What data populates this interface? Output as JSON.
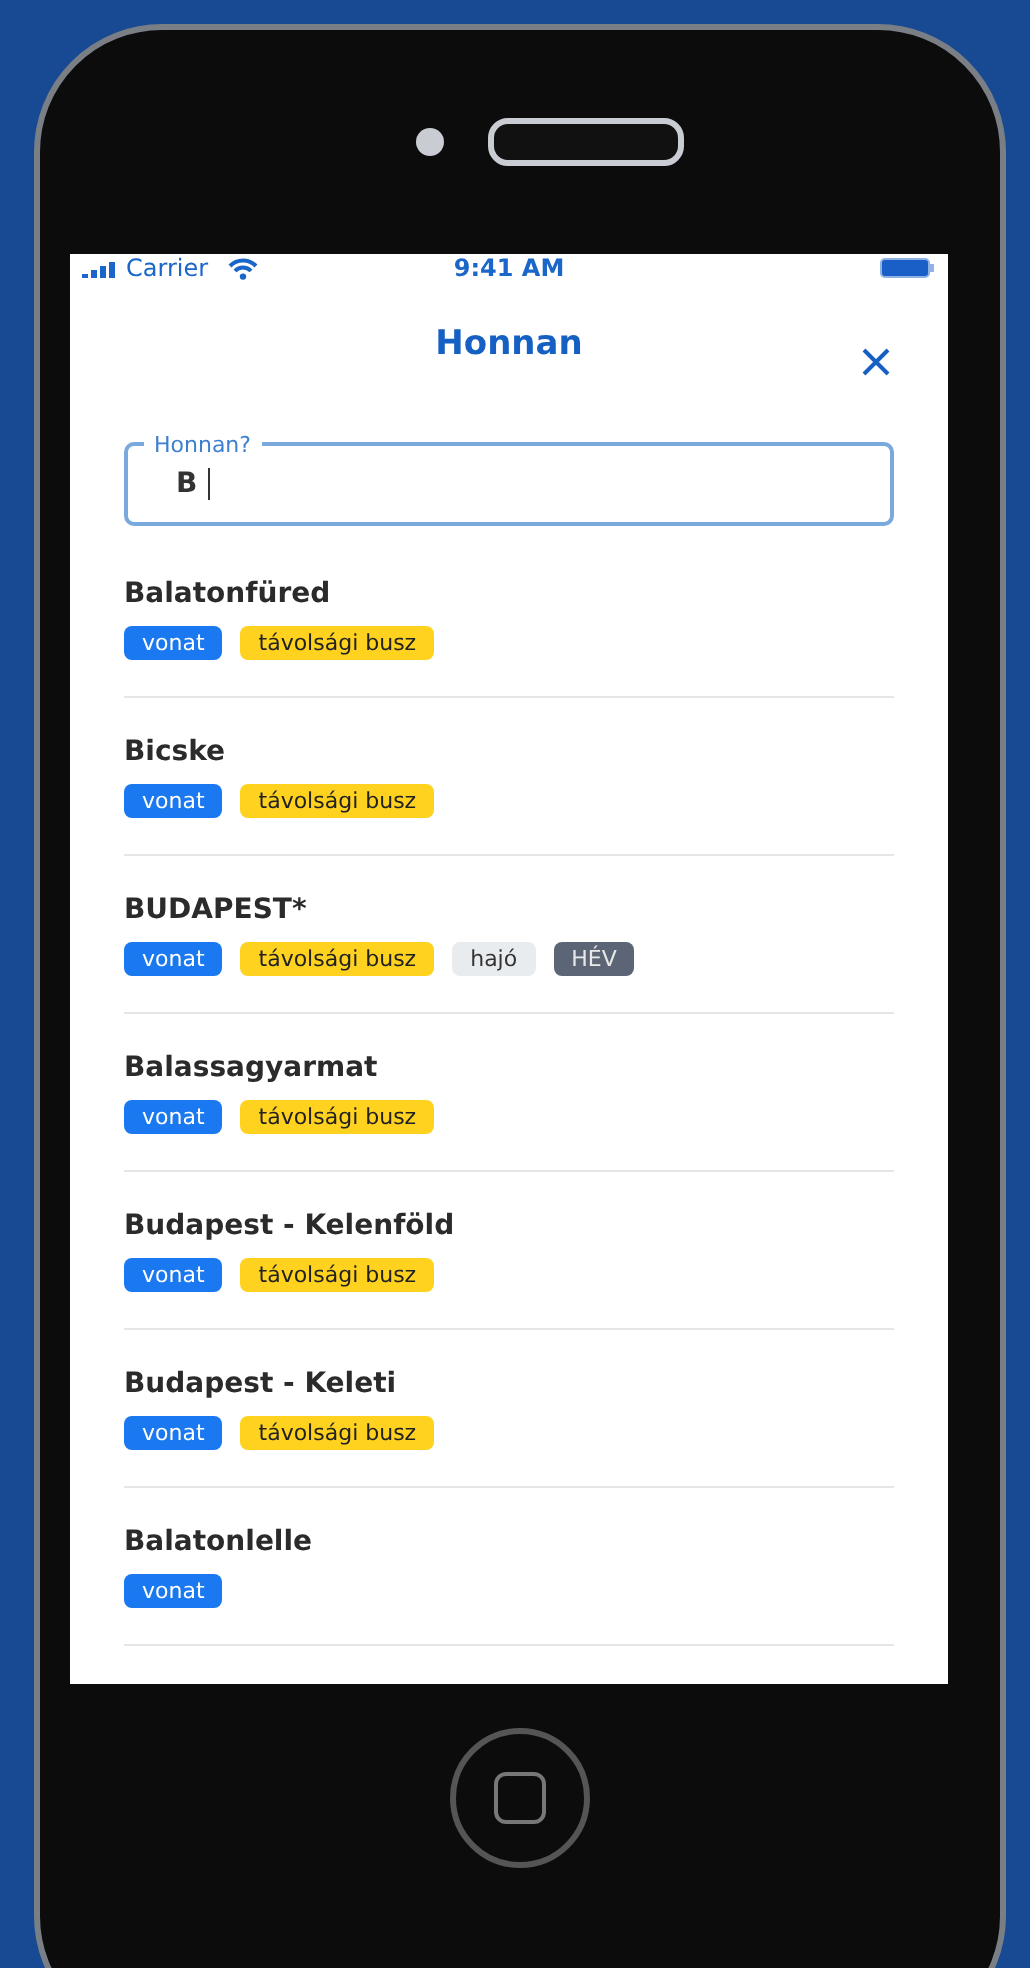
{
  "status_bar": {
    "carrier": "Carrier",
    "time": "9:41 AM"
  },
  "header": {
    "title": "Honnan"
  },
  "search": {
    "label": "Honnan?",
    "value": "B"
  },
  "results": [
    {
      "name": "Balatonfüred",
      "tags": [
        {
          "kind": "train",
          "label": "vonat"
        },
        {
          "kind": "bus",
          "label": "távolsági busz"
        }
      ]
    },
    {
      "name": "Bicske",
      "tags": [
        {
          "kind": "train",
          "label": "vonat"
        },
        {
          "kind": "bus",
          "label": "távolsági busz"
        }
      ]
    },
    {
      "name": "BUDAPEST*",
      "tags": [
        {
          "kind": "train",
          "label": "vonat"
        },
        {
          "kind": "bus",
          "label": "távolsági busz"
        },
        {
          "kind": "boat",
          "label": "hajó"
        },
        {
          "kind": "hev",
          "label": "HÉV"
        }
      ]
    },
    {
      "name": "Balassagyarmat",
      "tags": [
        {
          "kind": "train",
          "label": "vonat"
        },
        {
          "kind": "bus",
          "label": "távolsági busz"
        }
      ]
    },
    {
      "name": "Budapest - Kelenföld",
      "tags": [
        {
          "kind": "train",
          "label": "vonat"
        },
        {
          "kind": "bus",
          "label": "távolsági busz"
        }
      ]
    },
    {
      "name": "Budapest - Keleti",
      "tags": [
        {
          "kind": "train",
          "label": "vonat"
        },
        {
          "kind": "bus",
          "label": "távolsági busz"
        }
      ]
    },
    {
      "name": "Balatonlelle",
      "tags": [
        {
          "kind": "train",
          "label": "vonat"
        }
      ]
    }
  ]
}
